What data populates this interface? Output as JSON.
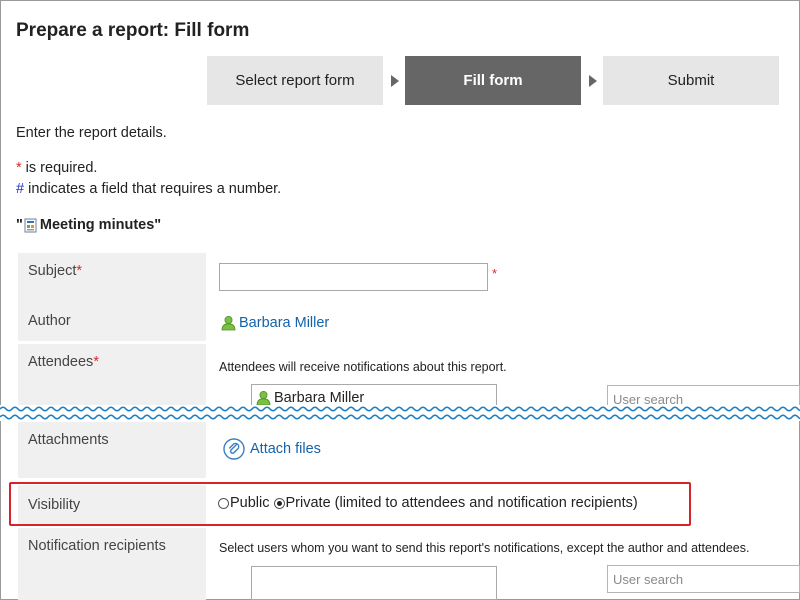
{
  "page": {
    "title": "Prepare a report: Fill form",
    "intro": "Enter the report details.",
    "required_mark": "*",
    "required_text": " is required.",
    "number_mark": "#",
    "number_text": " indicates a field that requires a number."
  },
  "steps": [
    {
      "label": "Select report form",
      "active": false
    },
    {
      "label": "Fill form",
      "active": true
    },
    {
      "label": "Submit",
      "active": false
    }
  ],
  "form": {
    "quote_open": "\"",
    "name": "Meeting minutes",
    "quote_close": "\""
  },
  "fields": {
    "subject": {
      "label": "Subject",
      "required": "*",
      "value": ""
    },
    "author": {
      "label": "Author",
      "user": "Barbara Miller"
    },
    "attendees": {
      "label": "Attendees",
      "required": "*",
      "note": "Attendees will receive notifications about this report.",
      "selected_user": "Barbara Miller",
      "search_placeholder": "User search"
    },
    "attachments": {
      "label": "Attachments",
      "action": "Attach files"
    },
    "visibility": {
      "label": "Visibility",
      "options": [
        {
          "label": "Public",
          "checked": false
        },
        {
          "label": "Private (limited to attendees and notification recipients)",
          "checked": true
        }
      ]
    },
    "notification_recipients": {
      "label": "Notification recipients",
      "note": "Select users whom you want to send this report's notifications, except the author and attendees.",
      "search_placeholder": "User search"
    }
  },
  "colors": {
    "required": "#e0262b",
    "number": "#1a33c9",
    "link": "#1463a8",
    "active_step": "#666666",
    "highlight": "#d6242b",
    "wave": "#1f7fc0"
  },
  "icons": [
    "report-form-icon",
    "user-icon",
    "paperclip-icon"
  ]
}
